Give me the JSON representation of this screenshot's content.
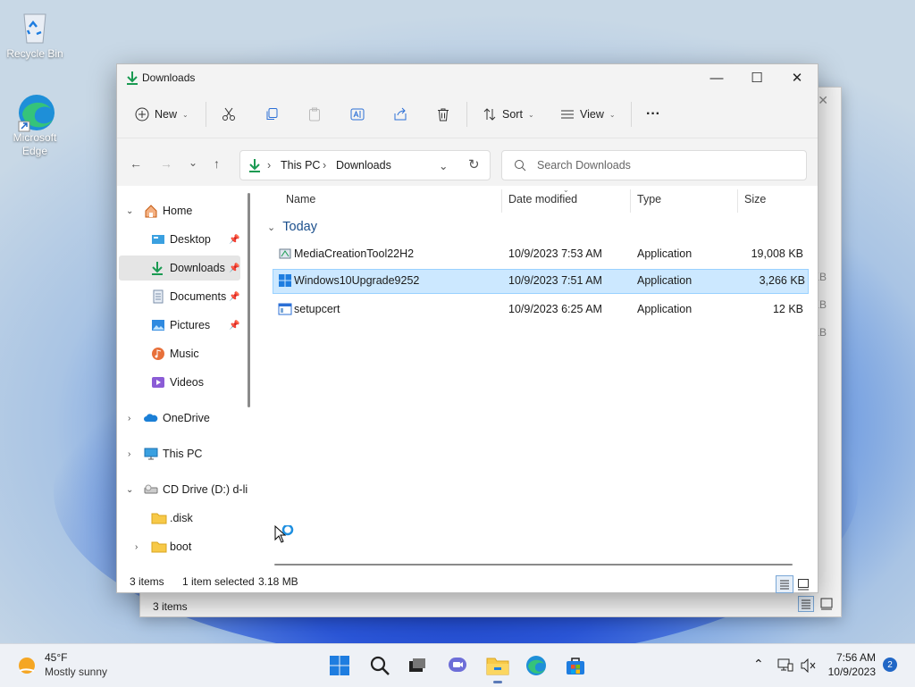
{
  "desktop": {
    "icons": [
      {
        "label": "Recycle Bin"
      },
      {
        "label_line1": "Microsoft",
        "label_line2": "Edge"
      }
    ]
  },
  "background_window": {
    "kb_fragments": [
      "KB",
      "KB",
      "KB"
    ],
    "status": "3 items"
  },
  "window": {
    "title": "Downloads",
    "controls": {
      "minimize": "—",
      "maximize": "☐",
      "close": "✕"
    },
    "toolbar": {
      "new_label": "New",
      "sort_label": "Sort",
      "view_label": "View",
      "more_label": "···"
    },
    "address": {
      "crumbs": [
        "This PC",
        "Downloads"
      ]
    },
    "search": {
      "placeholder": "Search Downloads"
    },
    "sidebar": {
      "items": [
        {
          "label": "Home"
        },
        {
          "label": "Desktop"
        },
        {
          "label": "Downloads"
        },
        {
          "label": "Documents"
        },
        {
          "label": "Pictures"
        },
        {
          "label": "Music"
        },
        {
          "label": "Videos"
        },
        {
          "label": "OneDrive"
        },
        {
          "label": "This PC"
        },
        {
          "label": "CD Drive (D:) d-li"
        },
        {
          "label": ".disk"
        },
        {
          "label": "boot"
        }
      ]
    },
    "columns": {
      "name": "Name",
      "date": "Date modified",
      "type": "Type",
      "size": "Size"
    },
    "group": "Today",
    "files": [
      {
        "name": "MediaCreationTool22H2",
        "date": "10/9/2023 7:53 AM",
        "type": "Application",
        "size": "19,008 KB"
      },
      {
        "name": "Windows10Upgrade9252",
        "date": "10/9/2023 7:51 AM",
        "type": "Application",
        "size": "3,266 KB"
      },
      {
        "name": "setupcert",
        "date": "10/9/2023 6:25 AM",
        "type": "Application",
        "size": "12 KB"
      }
    ],
    "status": {
      "count": "3 items",
      "selected": "1 item selected",
      "size": "3.18 MB"
    }
  },
  "taskbar": {
    "weather_temp": "45°F",
    "weather_desc": "Mostly sunny",
    "time": "7:56 AM",
    "date": "10/9/2023",
    "notification_count": "2"
  },
  "colors": {
    "accent": "#0067c0",
    "selection": "#cce8ff",
    "download_green": "#1a9a52"
  }
}
